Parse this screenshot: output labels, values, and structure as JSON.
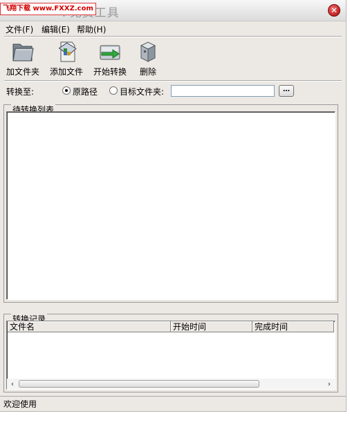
{
  "window": {
    "watermark": "飞翔下载 www.FXXZ.com",
    "title_visible": "F免费工具"
  },
  "menu": [
    {
      "label": "文件(F)"
    },
    {
      "label": "编辑(E)"
    },
    {
      "label": "帮助(H)"
    }
  ],
  "toolbar": [
    {
      "label": "加文件夹",
      "icon": "folder-icon"
    },
    {
      "label": "添加文件",
      "icon": "add-file-icon"
    },
    {
      "label": "开始转换",
      "icon": "convert-icon"
    },
    {
      "label": "删除",
      "icon": "delete-icon"
    }
  ],
  "convert": {
    "label": "转换至:",
    "option_source": "原路径",
    "option_target": "目标文件夹:",
    "selected": "原路径",
    "target_path": "",
    "browse_label": "…"
  },
  "pending": {
    "caption": "待转换列表"
  },
  "records": {
    "caption": "转换记录",
    "columns": [
      "文件名",
      "开始时间",
      "完成时间"
    ],
    "rows": []
  },
  "status": {
    "text": "欢迎使用"
  },
  "colors": {
    "window_bg": "#ece9e4",
    "close_button": "#c02020",
    "watermark_red": "#d10000"
  }
}
